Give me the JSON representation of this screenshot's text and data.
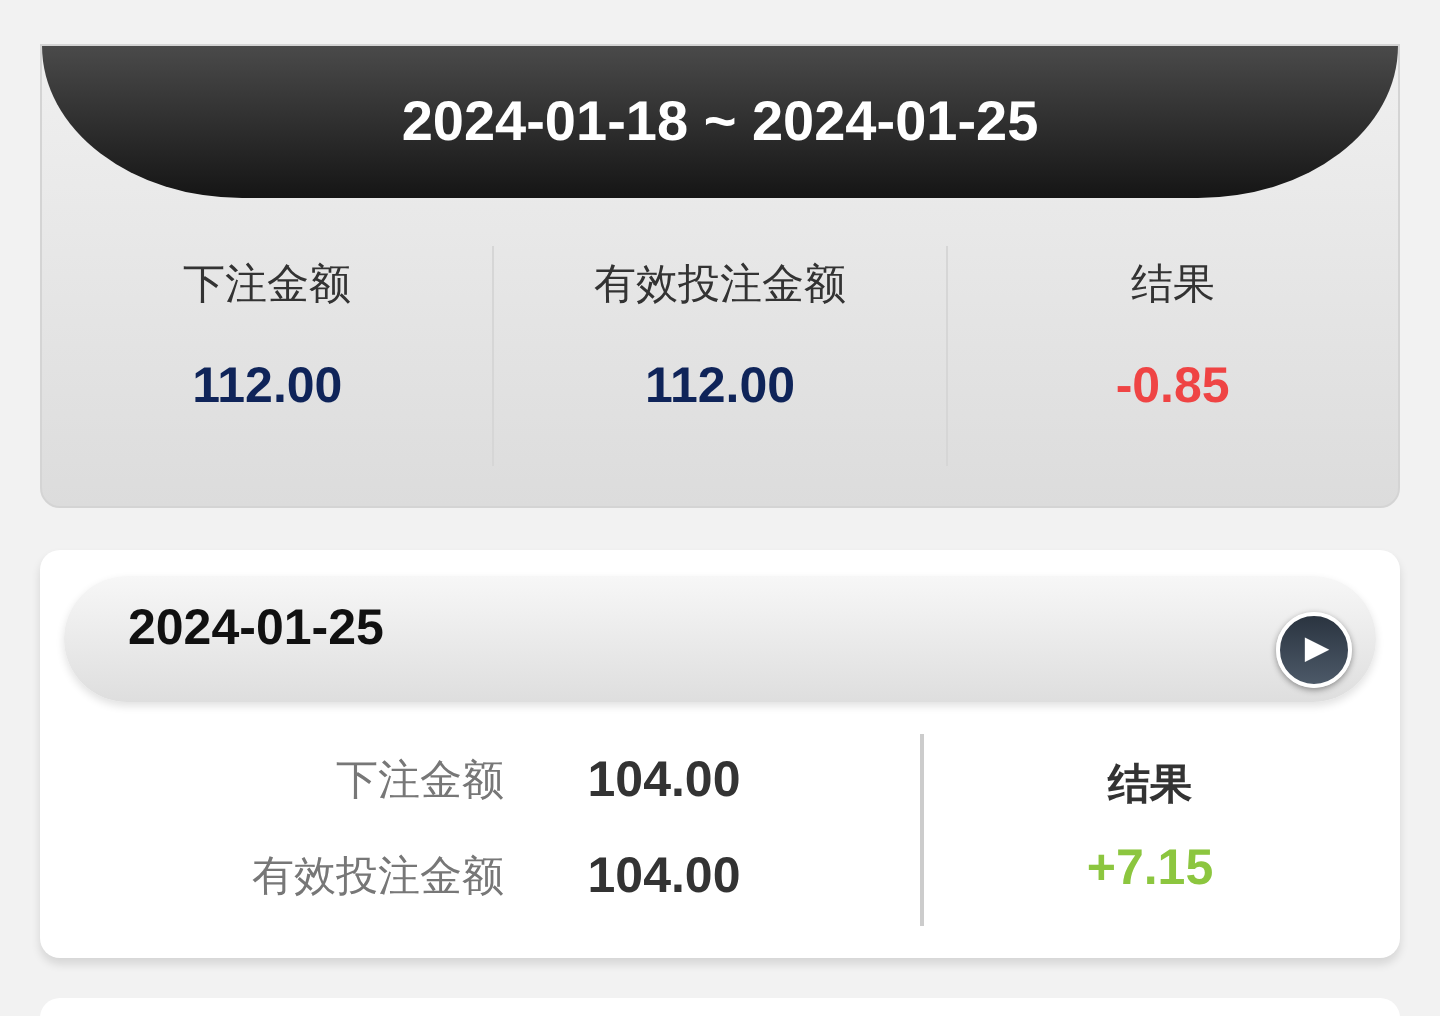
{
  "summary": {
    "range": "2024-01-18 ~ 2024-01-25",
    "stats": [
      {
        "label": "下注金额",
        "value": "112.00",
        "color": "#0f2459"
      },
      {
        "label": "有效投注金额",
        "value": "112.00",
        "color": "#0f2459"
      },
      {
        "label": "结果",
        "value": "-0.85",
        "color": "#ef4444"
      }
    ]
  },
  "days": [
    {
      "date": "2024-01-25",
      "expand_icon": "▶",
      "rows": [
        {
          "label": "下注金额",
          "value": "104.00"
        },
        {
          "label": "有效投注金额",
          "value": "104.00"
        }
      ],
      "result_label": "结果",
      "result": "+7.15",
      "color": "#8cc63f"
    }
  ]
}
